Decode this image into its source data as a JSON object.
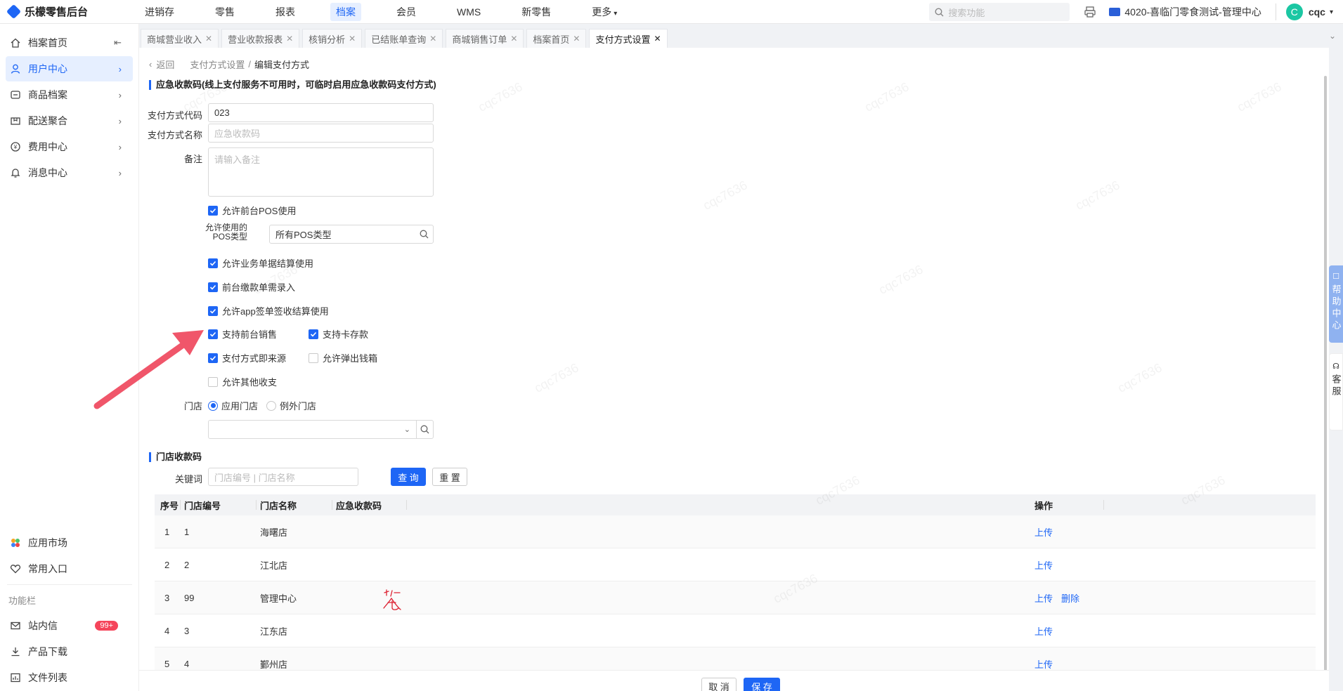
{
  "app": {
    "title": "乐檬零售后台"
  },
  "topnav": [
    "进销存",
    "零售",
    "报表",
    "档案",
    "会员",
    "WMS",
    "新零售",
    "更多"
  ],
  "search": {
    "placeholder": "搜索功能"
  },
  "org": "4020-喜临门零食测试-管理中心",
  "user": {
    "initial": "C",
    "name": "cqc"
  },
  "sidebar": {
    "items": [
      {
        "label": "档案首页",
        "icon": "home-icon"
      },
      {
        "label": "用户中心",
        "icon": "user-icon"
      },
      {
        "label": "商品档案",
        "icon": "box-icon"
      },
      {
        "label": "配送聚合",
        "icon": "delivery-icon"
      },
      {
        "label": "费用中心",
        "icon": "money-icon"
      },
      {
        "label": "消息中心",
        "icon": "bell-icon"
      }
    ],
    "bottom": [
      {
        "label": "应用市场",
        "icon": "apps-icon"
      },
      {
        "label": "常用入口",
        "icon": "heart-icon"
      }
    ],
    "section_label": "功能栏",
    "tools": [
      {
        "label": "站内信",
        "icon": "mail-icon",
        "badge": "99+"
      },
      {
        "label": "产品下载",
        "icon": "download-icon"
      },
      {
        "label": "文件列表",
        "icon": "file-list-icon"
      }
    ]
  },
  "tabs": [
    "商城营业收入",
    "营业收款报表",
    "核销分析",
    "已结账单查询",
    "商城销售订单",
    "档案首页",
    "支付方式设置"
  ],
  "breadcrumb": {
    "back": "返回",
    "parent": "支付方式设置",
    "sep": "/",
    "current": "编辑支付方式"
  },
  "form": {
    "section_title": "应急收款码(线上支付服务不可用时，可临时启用应急收款码支付方式)",
    "code_label": "支付方式代码",
    "code_value": "023",
    "name_label": "支付方式名称",
    "name_placeholder": "应急收款码",
    "remark_label": "备注",
    "remark_placeholder": "请输入备注",
    "cb_pos": "允许前台POS使用",
    "pos_type_label_1": "允许使用的",
    "pos_type_label_2": "POS类型",
    "pos_type_value": "所有POS类型",
    "cb_business": "允许业务单据结算使用",
    "cb_front_pay": "前台缴款单需录入",
    "cb_app": "允许app签单签收结算使用",
    "cb_front_sale": "支持前台销售",
    "cb_card": "支持卡存款",
    "cb_source": "支付方式即来源",
    "cb_drawer": "允许弹出钱箱",
    "cb_other": "允许其他收支",
    "store_label": "门店",
    "radio_apply": "应用门店",
    "radio_except": "例外门店"
  },
  "store_codes": {
    "section_title": "门店收款码",
    "keyword_label": "关键词",
    "keyword_placeholder": "门店编号 | 门店名称",
    "query": "查 询",
    "reset": "重 置",
    "headers": [
      "序号",
      "门店编号",
      "门店名称",
      "应急收款码",
      "操作"
    ],
    "rows": [
      {
        "no": "1",
        "code": "1",
        "name": "海曙店",
        "actions": [
          "上传"
        ]
      },
      {
        "no": "2",
        "code": "2",
        "name": "江北店",
        "actions": [
          "上传"
        ]
      },
      {
        "no": "3",
        "code": "99",
        "name": "管理中心",
        "actions": [
          "上传",
          "删除"
        ]
      },
      {
        "no": "4",
        "code": "3",
        "name": "江东店",
        "actions": [
          "上传"
        ]
      },
      {
        "no": "5",
        "code": "4",
        "name": "鄞州店",
        "actions": [
          "上传"
        ]
      }
    ]
  },
  "footer": {
    "cancel": "取 消",
    "save": "保 存"
  },
  "side_tabs": {
    "help": "帮助中心",
    "service": "客服"
  },
  "watermark": "cqc7636",
  "colors": {
    "primary": "#1e66f5",
    "danger": "#f5455b",
    "arrow": "#f0566a"
  }
}
